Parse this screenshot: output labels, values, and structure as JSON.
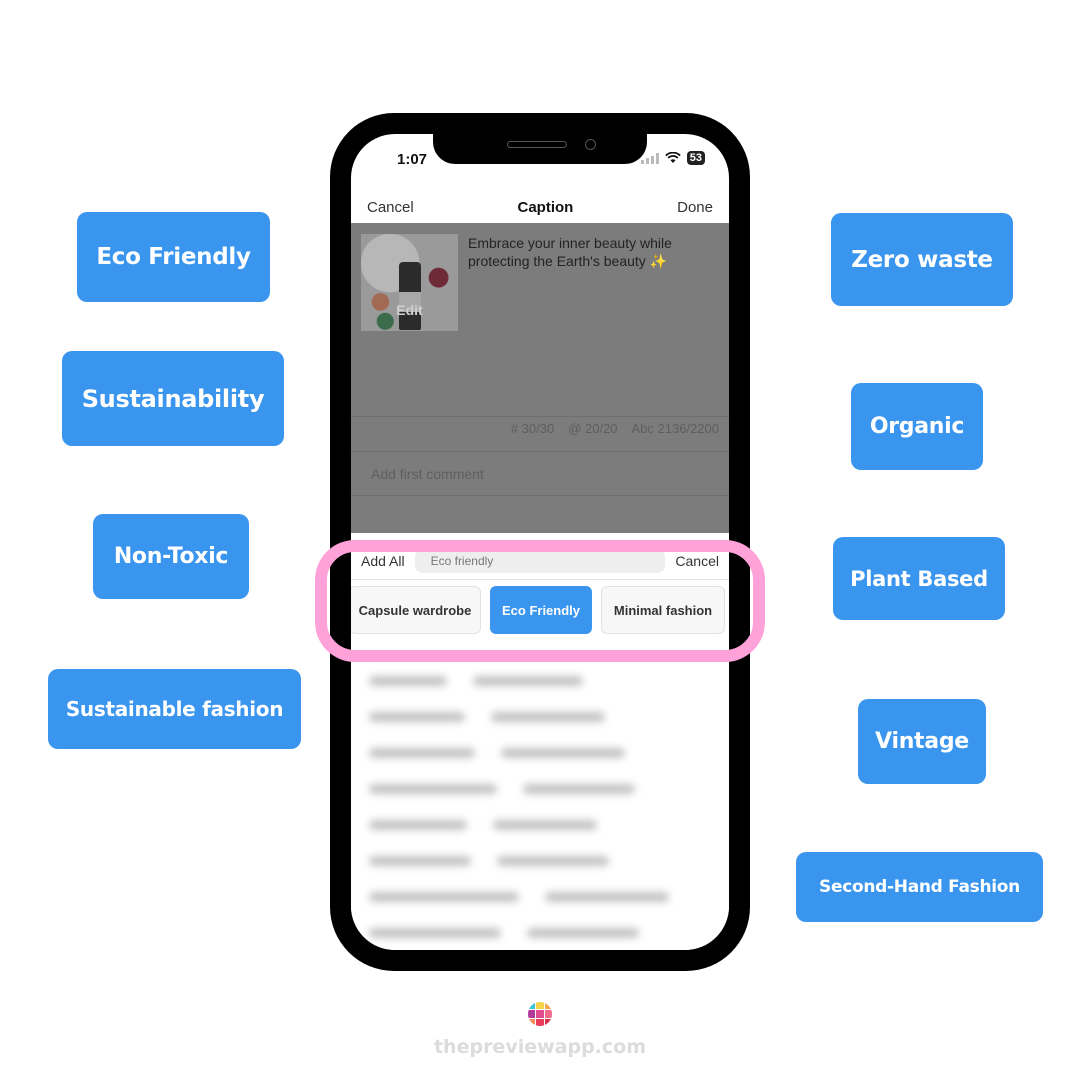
{
  "tags_left": [
    {
      "label": "Eco Friendly"
    },
    {
      "label": "Sustainability"
    },
    {
      "label": "Non-Toxic"
    },
    {
      "label": "Sustainable fashion"
    }
  ],
  "tags_right": [
    {
      "label": "Zero waste"
    },
    {
      "label": "Organic"
    },
    {
      "label": "Plant Based"
    },
    {
      "label": "Vintage"
    },
    {
      "label": "Second-Hand Fashion"
    }
  ],
  "phone": {
    "status": {
      "time": "1:07",
      "battery": "53"
    },
    "navbar": {
      "cancel": "Cancel",
      "title": "Caption",
      "done": "Done"
    },
    "post": {
      "thumb_edit": "Edit",
      "caption": "Embrace your inner beauty while protecting the Earth's beauty ✨"
    },
    "counts": {
      "hashtags": "# 30/30",
      "mentions": "@ 20/20",
      "characters": "Abc 2136/2200"
    },
    "comment_placeholder": "Add first comment",
    "hashtag_sheet": {
      "add_all": "Add All",
      "search_value": "Eco friendly",
      "cancel": "Cancel",
      "chips": [
        {
          "label": "Capsule wardrobe",
          "active": false
        },
        {
          "label": "Eco Friendly",
          "active": true
        },
        {
          "label": "Minimal fashion",
          "active": false
        }
      ]
    }
  },
  "colors": {
    "tag_blue": "#3a95ee",
    "highlight_pink": "#ffa2da"
  },
  "branding": {
    "site": "thepreviewapp.com"
  }
}
